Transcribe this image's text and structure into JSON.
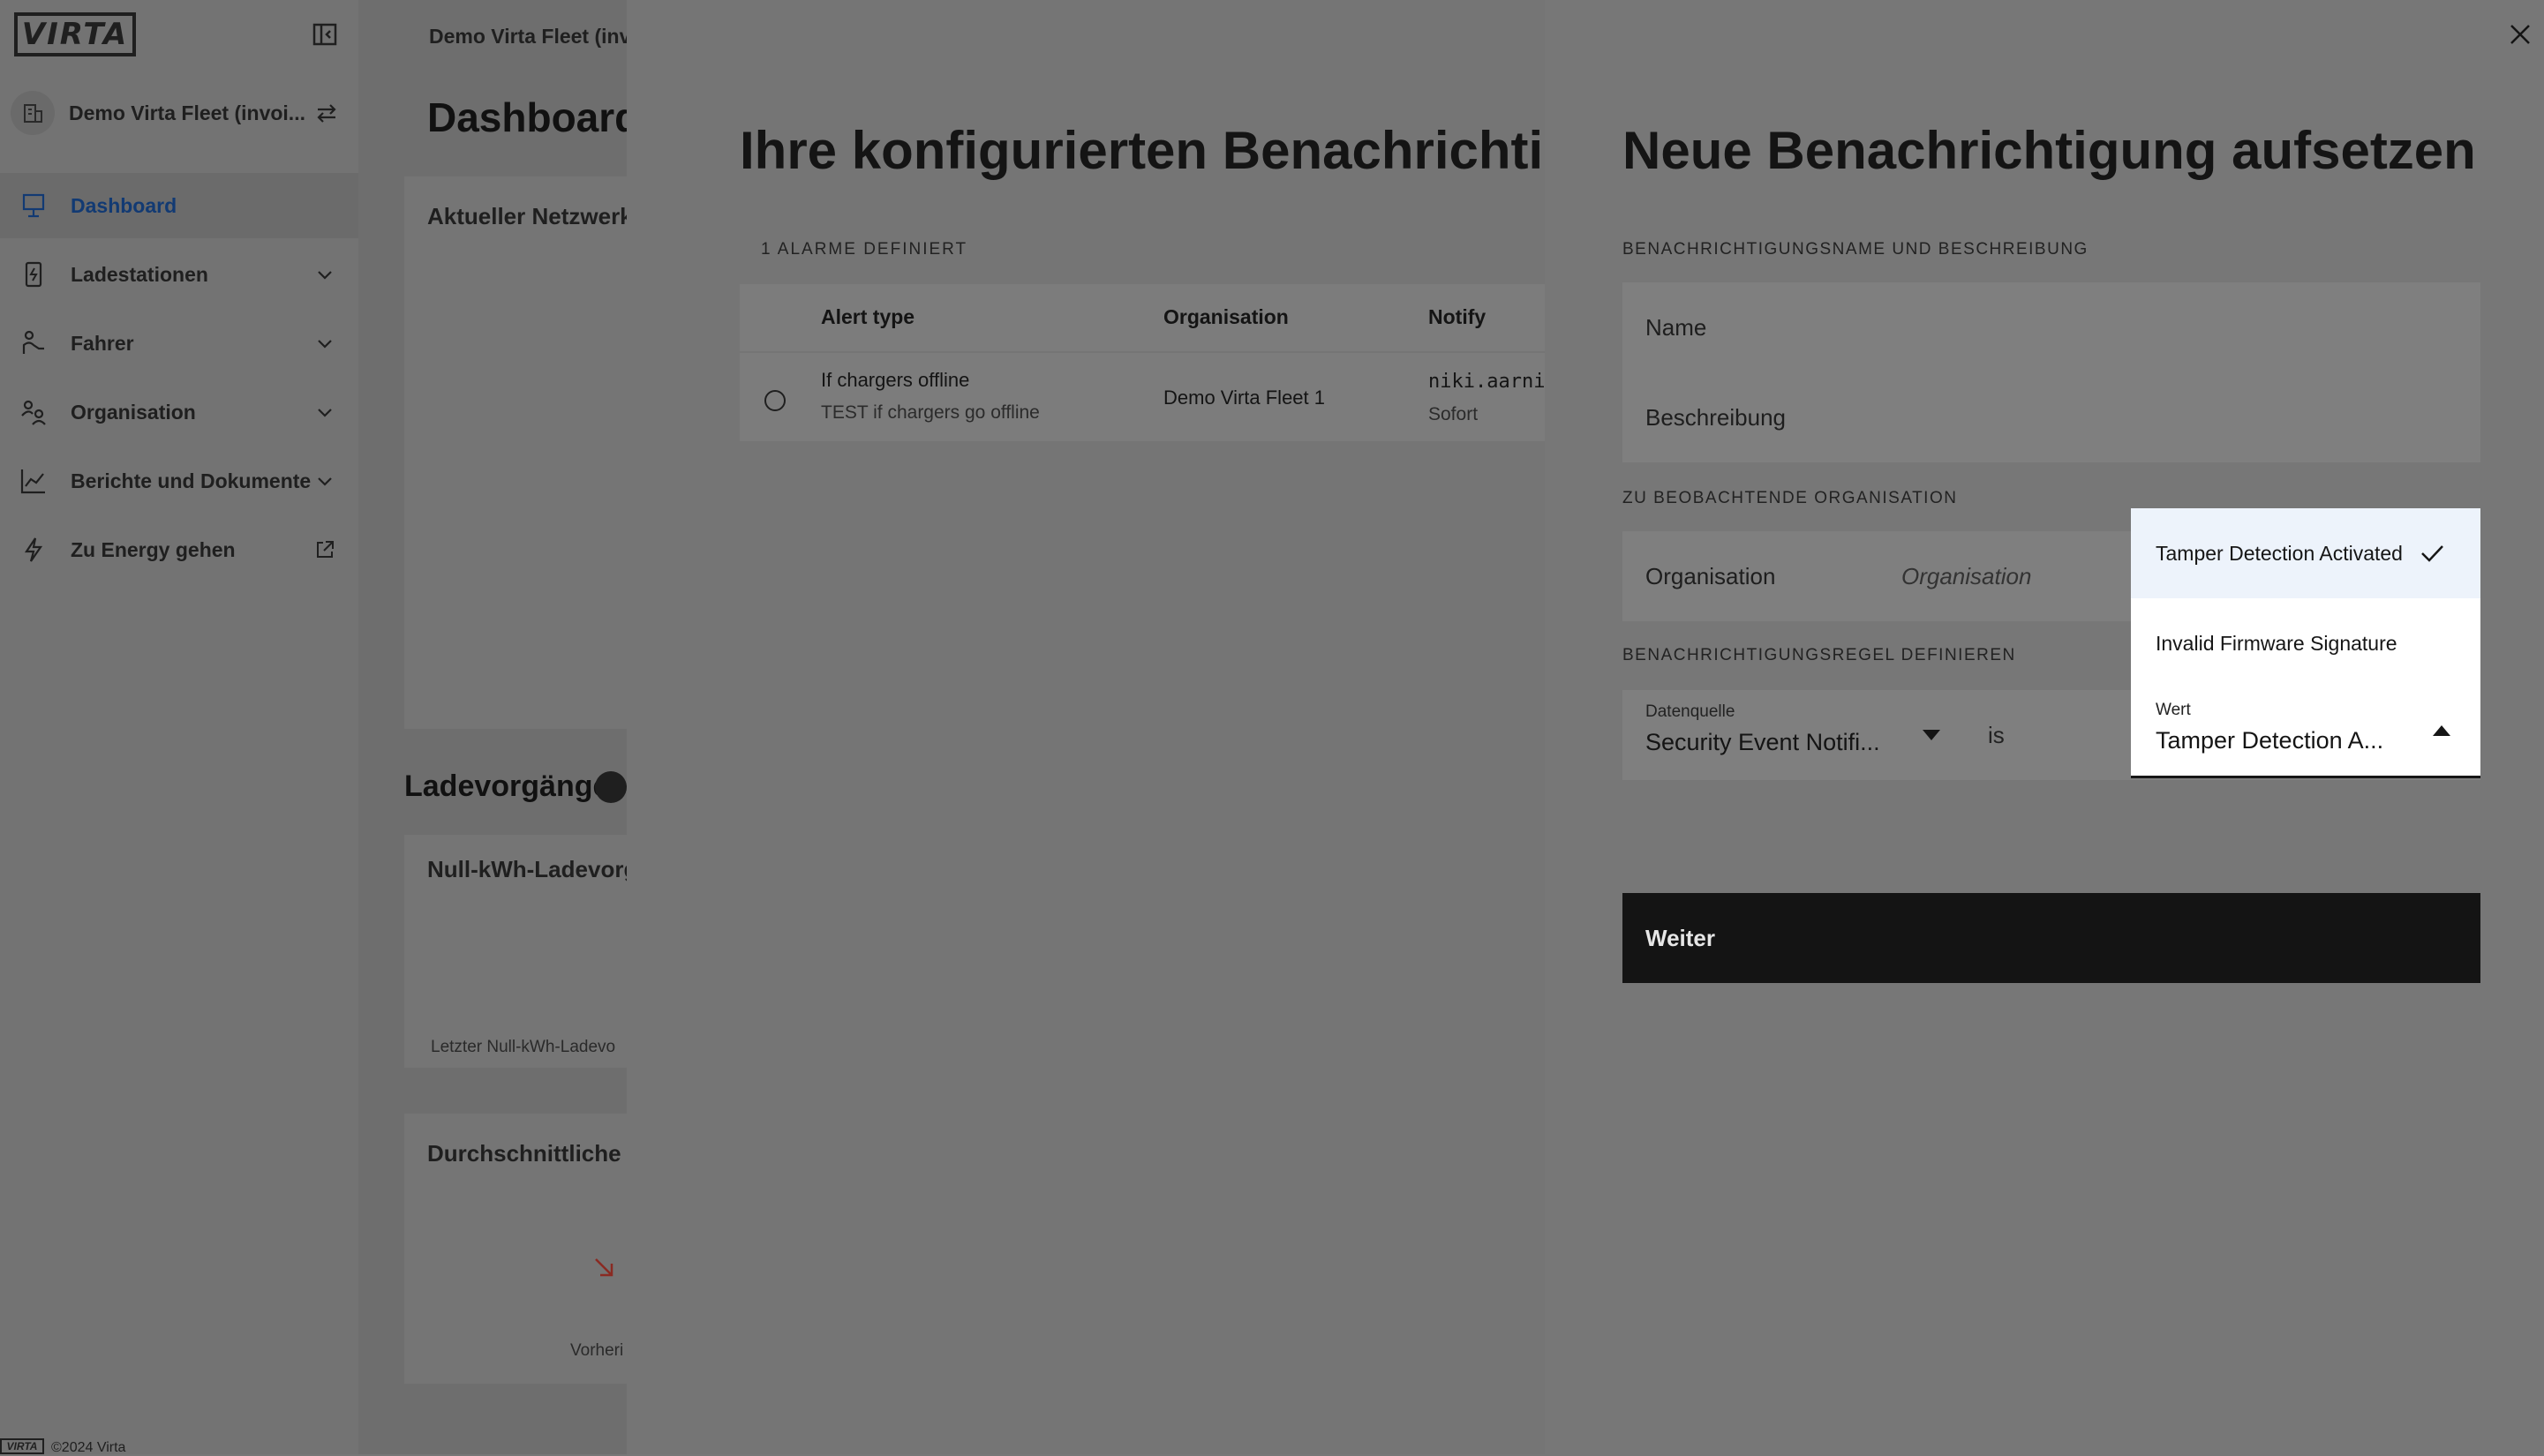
{
  "sidebar": {
    "logo": "VIRTA",
    "org_name": "Demo Virta Fleet (invoi...",
    "nav": [
      {
        "label": "Dashboard",
        "icon": "dashboard-icon",
        "active": true
      },
      {
        "label": "Ladestationen",
        "icon": "charger-icon"
      },
      {
        "label": "Fahrer",
        "icon": "driver-icon"
      },
      {
        "label": "Organisation",
        "icon": "organisation-icon"
      },
      {
        "label": "Berichte und Dokumente",
        "icon": "chart-icon"
      },
      {
        "label": "Zu Energy gehen",
        "icon": "bolt-icon"
      }
    ],
    "footer_logo": "VIRTA",
    "footer_copyright": "©2024 Virta"
  },
  "dashboard": {
    "fleet_title": "Demo Virta Fleet (inv",
    "title": "Dashboard",
    "network_card_title": "Aktueller Netzwerk",
    "sessions_title": "Ladevorgänge",
    "null_kwh_title": "Null-kWh-Ladevorg",
    "null_kwh_sub": "Letzter Null-kWh-Ladevo",
    "avg_title": "Durchschnittliche L",
    "avg_sub": "Vorheri"
  },
  "alerts_panel": {
    "title": "Ihre konfigurierten Benachrichtigu",
    "count_label": "1 ALARME DEFINIERT",
    "columns": [
      "Alert type",
      "Organisation",
      "Notify"
    ],
    "rows": [
      {
        "alert_type": "If chargers offline",
        "description": "TEST if chargers go offline",
        "organisation": "Demo Virta Fleet 1",
        "notify": "niki.aarni",
        "frequency": "Sofort"
      }
    ]
  },
  "new_notification": {
    "title": "Neue Benachrichtigung aufsetzen",
    "name_section_label": "BENACHRICHTIGUNGSNAME UND BESCHREIBUNG",
    "name_placeholder": "Name",
    "description_placeholder": "Beschreibung",
    "org_section_label": "ZU BEOBACHTENDE ORGANISATION",
    "org_field_label": "Organisation",
    "org_placeholder": "Organisation",
    "rule_section_label": "BENACHRICHTIGUNGSREGEL DEFINIEREN",
    "datasource_label": "Datenquelle",
    "datasource_value": "Security Event Notifi...",
    "operator": "is",
    "value_label": "Wert",
    "value_selected": "Tamper Detection A...",
    "submit_label": "Weiter"
  },
  "value_dropdown": {
    "options": [
      {
        "label": "Tamper Detection Activated",
        "selected": true
      },
      {
        "label": "Invalid Firmware Signature",
        "selected": false
      }
    ]
  }
}
